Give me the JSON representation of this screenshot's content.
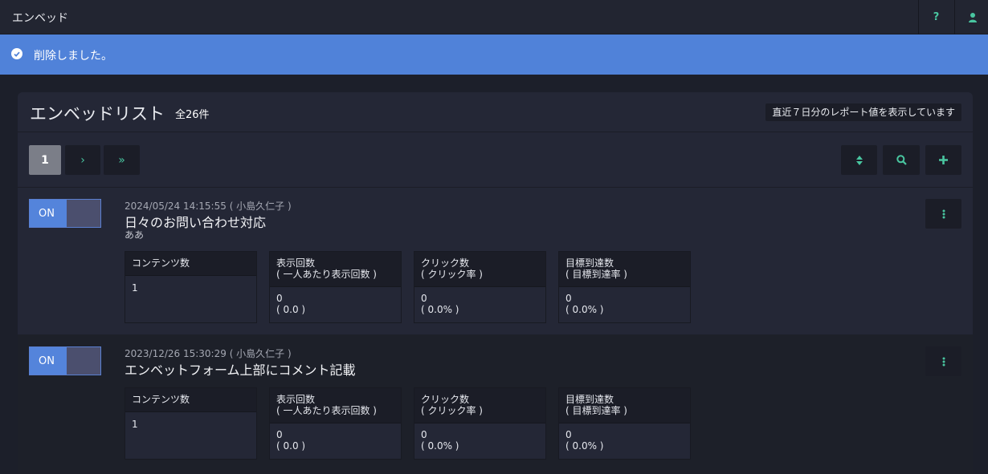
{
  "topbar": {
    "title": "エンベッド",
    "help_label": "?",
    "colors": {
      "bg": "#222531",
      "icon": "#49c6a0"
    }
  },
  "alert": {
    "message": "削除しました。",
    "color": "#5082d9"
  },
  "panel": {
    "title": "エンベッドリスト",
    "count": "全26件",
    "report_note": "直近７日分のレポート値を表示しています"
  },
  "pagination": {
    "current": "1",
    "next_glyph": "›",
    "last_glyph": "»"
  },
  "toolbar": {
    "sort_icon": "sort-icon",
    "search_icon": "search-icon",
    "add_icon": "plus-icon"
  },
  "embeds": [
    {
      "toggle": "ON",
      "meta": "2024/05/24 14:15:55 ( 小島久仁子 )",
      "name": "日々のお問い合わせ対応",
      "description": "ああ",
      "stats": {
        "contents": {
          "label": "コンテンツ数",
          "value": "1"
        },
        "impressions": {
          "label1": "表示回数",
          "label2": "( 一人あたり表示回数 )",
          "value1": "0",
          "value2": "( 0.0 )"
        },
        "clicks": {
          "label1": "クリック数",
          "label2": "( クリック率 )",
          "value1": "0",
          "value2": "( 0.0% )"
        },
        "goals": {
          "label1": "目標到達数",
          "label2": "( 目標到達率 )",
          "value1": "0",
          "value2": "( 0.0% )"
        }
      }
    },
    {
      "toggle": "ON",
      "meta": "2023/12/26 15:30:29 ( 小島久仁子 )",
      "name": "エンベットフォーム上部にコメント記載",
      "description": "",
      "stats": {
        "contents": {
          "label": "コンテンツ数",
          "value": "1"
        },
        "impressions": {
          "label1": "表示回数",
          "label2": "( 一人あたり表示回数 )",
          "value1": "0",
          "value2": "( 0.0 )"
        },
        "clicks": {
          "label1": "クリック数",
          "label2": "( クリック率 )",
          "value1": "0",
          "value2": "( 0.0% )"
        },
        "goals": {
          "label1": "目標到達数",
          "label2": "( 目標到達率 )",
          "value1": "0",
          "value2": "( 0.0% )"
        }
      }
    }
  ]
}
